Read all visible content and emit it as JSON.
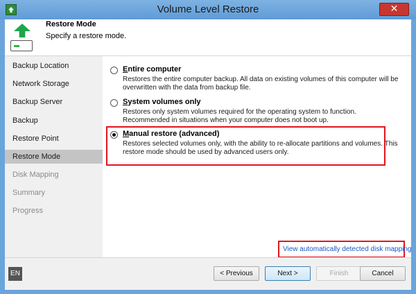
{
  "window": {
    "title": "Volume Level Restore",
    "close_glyph": "✕"
  },
  "header": {
    "title": "Restore Mode",
    "subtitle": "Specify a restore mode."
  },
  "sidebar": {
    "items": [
      {
        "label": "Backup Location",
        "state": "normal"
      },
      {
        "label": "Network Storage",
        "state": "normal"
      },
      {
        "label": "Backup Server",
        "state": "normal"
      },
      {
        "label": "Backup",
        "state": "normal"
      },
      {
        "label": "Restore Point",
        "state": "normal"
      },
      {
        "label": "Restore Mode",
        "state": "active"
      },
      {
        "label": "Disk Mapping",
        "state": "disabled"
      },
      {
        "label": "Summary",
        "state": "disabled"
      },
      {
        "label": "Progress",
        "state": "disabled"
      }
    ]
  },
  "options": [
    {
      "label": "Entire computer",
      "accesskey": "E",
      "checked": false,
      "desc": "Restores the entire computer backup. All data on existing volumes of this computer will be overwritten with the data from backup file."
    },
    {
      "label": "System volumes only",
      "accesskey": "S",
      "checked": false,
      "desc": "Restores only system volumes required for the operating system to function. Recommended in situations when your computer does not boot up."
    },
    {
      "label": "Manual restore (advanced)",
      "accesskey": "M",
      "checked": true,
      "desc": "Restores selected volumes only, with the ability to re-allocate partitions and volumes. This restore mode should be used by advanced users only."
    }
  ],
  "link": {
    "label": "View automatically detected disk mapping"
  },
  "footer": {
    "language": "EN",
    "previous_label": "< Previous",
    "next_label": "Next >",
    "finish_label": "Finish",
    "cancel_label": "Cancel"
  },
  "colors": {
    "highlight": "#e0151f",
    "title_bar": "#6aa4dc",
    "link": "#1a57c4",
    "active_nav": "#c4c4c4"
  }
}
